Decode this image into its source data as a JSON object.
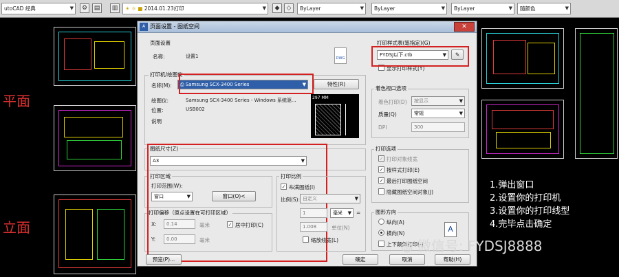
{
  "toolbar": {
    "workspace": "utoCAD 经典",
    "date_layer": "2014.01.23打印",
    "color": "ByLayer",
    "linetype": "ByLayer",
    "lineweight": "ByLayer",
    "plotstyle": "随颜色"
  },
  "side_labels": {
    "plan": "平面",
    "elevation": "立面"
  },
  "dialog": {
    "title": "页面设置 - 图纸空间",
    "page_setup": {
      "group": "页面设置",
      "name_label": "名称:",
      "name_value": "设置1",
      "dwg_icon": "DWG"
    },
    "printer": {
      "group": "打印机/绘图仪",
      "name_label": "名称(M):",
      "name_value": "Samsung SCX-3400 Series",
      "properties_button": "特性(R)",
      "plotter_label": "绘图仪:",
      "plotter_value": "Samsung SCX-3400 Series - Windows 系统驱...",
      "location_label": "位置:",
      "location_value": "USB002",
      "description_label": "说明",
      "paper_width": "297 MM"
    },
    "plot_style_table": {
      "group": "打印样式表(笔指定)(G)",
      "value": "FYDSJ以下.ctb",
      "show_styles_label": "显示打印样式(Y)"
    },
    "shaded_viewport": {
      "group": "着色视口选项",
      "shade_plot_label": "着色打印(D)",
      "shade_plot_value": "按显示",
      "quality_label": "质量(Q)",
      "quality_value": "常规",
      "dpi_label": "DPI",
      "dpi_value": "300"
    },
    "paper_size": {
      "group": "图纸尺寸(Z)",
      "value": "A3"
    },
    "plot_area": {
      "group": "打印区域",
      "range_label": "打印范围(W):",
      "range_value": "窗口",
      "window_button": "窗口(O)<"
    },
    "plot_offset": {
      "group": "打印偏移（原点设置在可打印区域）",
      "x_label": "X:",
      "x_value": "0.14",
      "x_unit": "毫米",
      "y_label": "Y:",
      "y_value": "0.00",
      "y_unit": "毫米",
      "center_label": "居中打印(C)"
    },
    "plot_scale": {
      "group": "打印比例",
      "fit_label": "布满图纸(I)",
      "scale_label": "比例(S):",
      "scale_value": "自定义",
      "value1": "1",
      "unit1": "毫米",
      "value2": "1.008",
      "unit2": "单位(N)",
      "lineweights_label": "缩放线宽(L)"
    },
    "plot_options": {
      "group": "打印选项",
      "items": [
        {
          "label": "打印对象线宽",
          "checked": true,
          "enabled": false
        },
        {
          "label": "按样式打印(E)",
          "checked": true,
          "enabled": true
        },
        {
          "label": "最后打印图纸空间",
          "checked": true,
          "enabled": true
        },
        {
          "label": "隐藏图纸空间对象(J)",
          "checked": false,
          "enabled": true
        }
      ]
    },
    "orientation": {
      "group": "图形方向",
      "portrait_label": "纵向(A)",
      "landscape_label": "横向(N)",
      "upside_label": "上下颠倒打印(-)"
    },
    "buttons": {
      "preview": "预览(P)...",
      "ok": "确定",
      "cancel": "取消",
      "help": "帮助(H)"
    }
  },
  "annotations": {
    "steps": [
      "1.弹出窗口",
      "2.设置你的打印机",
      "3.设置你的打印线型",
      "4.完毕点击确定"
    ],
    "wechat": "微信号: FYDSJ8888"
  },
  "colors": {
    "highlight_box": "#d42020",
    "selection": "#2f5fa8",
    "cad_background": "#000000"
  }
}
